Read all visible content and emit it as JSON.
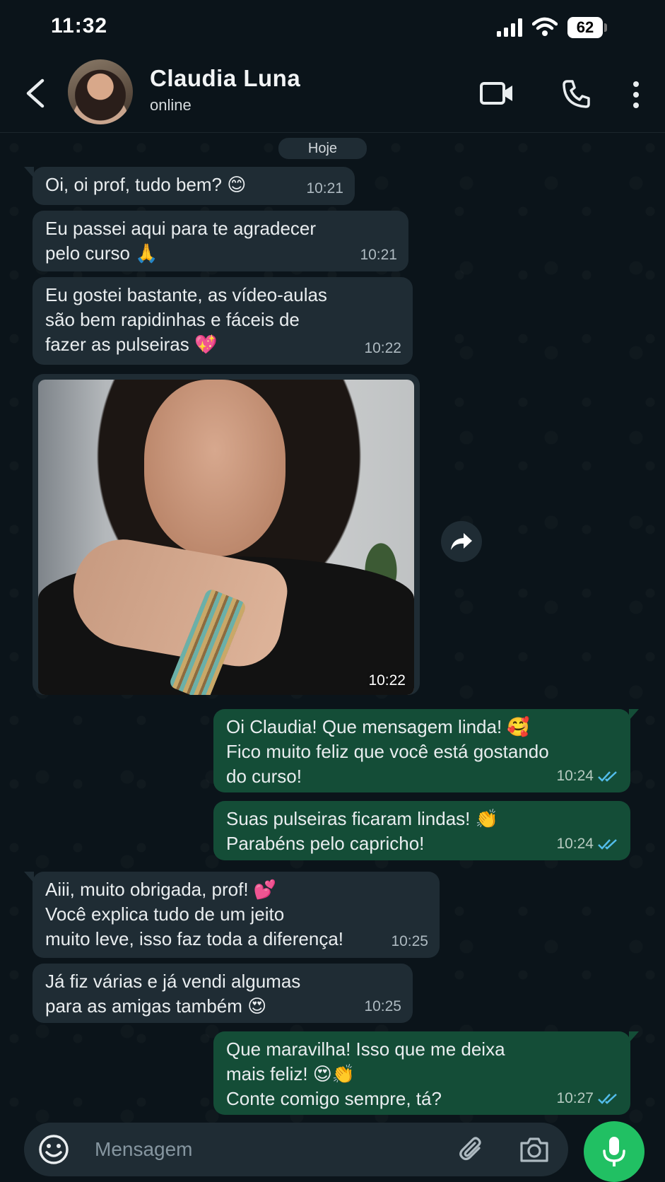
{
  "status_bar": {
    "time": "11:32",
    "battery": "62",
    "icons": [
      "cellular-signal-icon",
      "wifi-icon",
      "battery-icon"
    ]
  },
  "header": {
    "contact_name": "Claudia Luna",
    "contact_status": "online",
    "icons": [
      "back-arrow-icon",
      "video-call-icon",
      "voice-call-icon",
      "more-options-icon"
    ]
  },
  "colors": {
    "background": "#0b141a",
    "incoming_bubble": "#1f2c34",
    "outgoing_bubble": "#144d37",
    "accent_green": "#21c063",
    "read_ticks": "#53bdeb"
  },
  "chat": {
    "date_label": "Hoje",
    "messages": [
      {
        "direction": "in",
        "text": "Oi, oi prof, tudo bem? 😊",
        "time": "10:21"
      },
      {
        "direction": "in",
        "text": "Eu passei aqui para te agradecer\npelo curso 🙏",
        "time": "10:21"
      },
      {
        "direction": "in",
        "text": "Eu gostei bastante, as vídeo-aulas\nsão bem rapidinhas e fáceis de\nfazer as pulseiras 💖",
        "time": "10:22"
      },
      {
        "direction": "in",
        "type": "image",
        "time": "10:22"
      },
      {
        "direction": "out",
        "text": "Oi Claudia! Que mensagem linda! 🥰\nFico muito feliz que você está gostando\ndo curso!",
        "time": "10:24",
        "status": "read"
      },
      {
        "direction": "out",
        "text": "Suas pulseiras ficaram lindas! 👏\nParabéns pelo capricho!",
        "time": "10:24",
        "status": "read"
      },
      {
        "direction": "in",
        "text": "Aiii, muito obrigada, prof! 💕\nVocê explica tudo de um jeito\nmuito leve, isso faz toda a diferença!",
        "time": "10:25"
      },
      {
        "direction": "in",
        "text": "Já fiz várias e já vendi algumas\npara as amigas também 😍",
        "time": "10:25"
      },
      {
        "direction": "out",
        "text": "Que maravilha! Isso que me deixa\nmais feliz! 😍👏\nConte comigo sempre, tá?",
        "time": "10:27",
        "status": "read"
      }
    ]
  },
  "input": {
    "placeholder": "Mensagem",
    "value": "",
    "icons": [
      "emoji-icon",
      "attach-icon",
      "camera-icon",
      "microphone-icon"
    ]
  }
}
